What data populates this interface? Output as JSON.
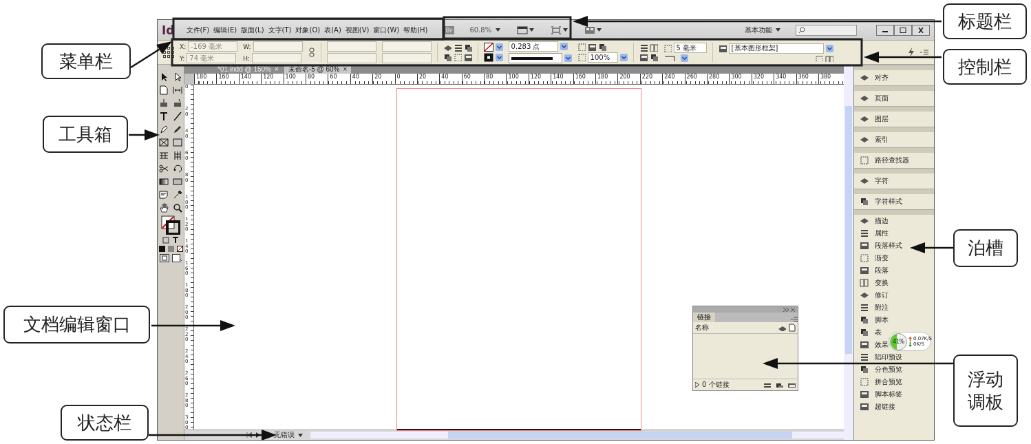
{
  "window": {
    "logo": "Id",
    "menus": [
      "文件(F)",
      "编辑(E)",
      "版面(L)",
      "文字(T)",
      "对象(O)",
      "表(A)",
      "视图(V)",
      "窗口(W)",
      "帮助(H)"
    ],
    "bridge": "Br",
    "zoom": "60.8%",
    "workspace": "基本功能"
  },
  "control_bar": {
    "x_label": "X:",
    "x_value": "-169 毫米",
    "y_label": "Y:",
    "y_value": "74 毫米",
    "w_label": "W:",
    "h_label": "H:",
    "stroke_weight": "0.283 点",
    "scale": "100%",
    "corner_size": "5 毫米",
    "frame_style": "[基本图形框架]"
  },
  "document_tabs": [
    {
      "label": "*01.indd @ 150%",
      "close": "×",
      "selected": false
    },
    {
      "label": "未命名-5 @ 60%",
      "close": "×",
      "selected": true
    }
  ],
  "rulers": {
    "horizontal": [
      "180",
      "160",
      "140",
      "120",
      "100",
      "80",
      "60",
      "40",
      "20",
      "0",
      "20",
      "40",
      "60",
      "80",
      "100",
      "120",
      "140",
      "160",
      "180",
      "200",
      "220",
      "240",
      "260",
      "280",
      "300",
      "320",
      "340",
      "360",
      "380"
    ],
    "vertical": [
      "0",
      "20",
      "40",
      "60",
      "80",
      "100",
      "120",
      "140",
      "160",
      "180",
      "200",
      "220",
      "240",
      "260",
      "280",
      "300"
    ]
  },
  "dock_groups": [
    {
      "items": [
        {
          "label": "对齐"
        }
      ]
    },
    {
      "items": [
        {
          "label": "页面"
        }
      ]
    },
    {
      "items": [
        {
          "label": "图层"
        }
      ]
    },
    {
      "items": [
        {
          "label": "索引"
        }
      ]
    },
    {
      "items": [
        {
          "label": "路径查找器"
        }
      ]
    },
    {
      "items": [
        {
          "label": "字符"
        }
      ]
    },
    {
      "items": [
        {
          "label": "字符样式"
        }
      ]
    },
    {
      "items": [
        {
          "label": "描边"
        },
        {
          "label": "属性"
        },
        {
          "label": "段落样式"
        },
        {
          "label": "渐变"
        },
        {
          "label": "段落"
        },
        {
          "label": "变换"
        },
        {
          "label": "修订"
        },
        {
          "label": "附注"
        },
        {
          "label": "脚本"
        },
        {
          "label": "表"
        },
        {
          "label": "效果"
        },
        {
          "label": "陷印预设"
        },
        {
          "label": "分色预览"
        },
        {
          "label": "拼合预览"
        },
        {
          "label": "脚本标签"
        },
        {
          "label": "超链接"
        }
      ]
    }
  ],
  "floating_panel": {
    "tab": "链接",
    "column": "名称",
    "footer": "0 个链接"
  },
  "status_bar": {
    "status": "无错误"
  },
  "network_widget": {
    "percent": "41%",
    "level": 0.41,
    "upload": "0.07K/S",
    "download": "0K/S"
  },
  "annotations": [
    {
      "label": "菜单栏"
    },
    {
      "label": "工具箱"
    },
    {
      "label": "文档编辑窗口"
    },
    {
      "label": "状态栏"
    },
    {
      "label": "标题栏"
    },
    {
      "label": "控制栏"
    },
    {
      "label": "泊槽"
    },
    {
      "label": "浮动调板"
    }
  ]
}
